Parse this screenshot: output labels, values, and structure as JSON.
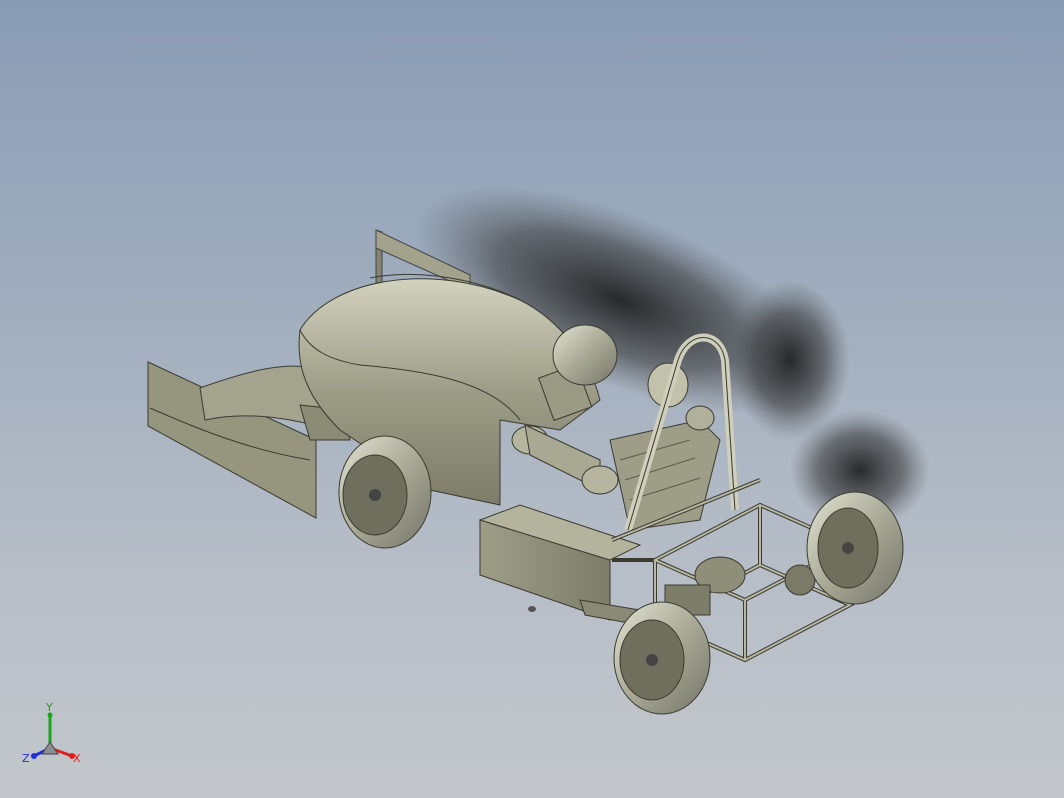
{
  "viewport": {
    "background_top": "#8a9cb5",
    "background_bottom": "#c3c7cc"
  },
  "model": {
    "body_color": "#8c8c78",
    "shadow_color": "#2b2b2b"
  },
  "triad": {
    "x_label": "X",
    "y_label": "Y",
    "z_label": "Z",
    "x_color": "#e0201a",
    "y_color": "#1aa51a",
    "z_color": "#2030d8"
  }
}
